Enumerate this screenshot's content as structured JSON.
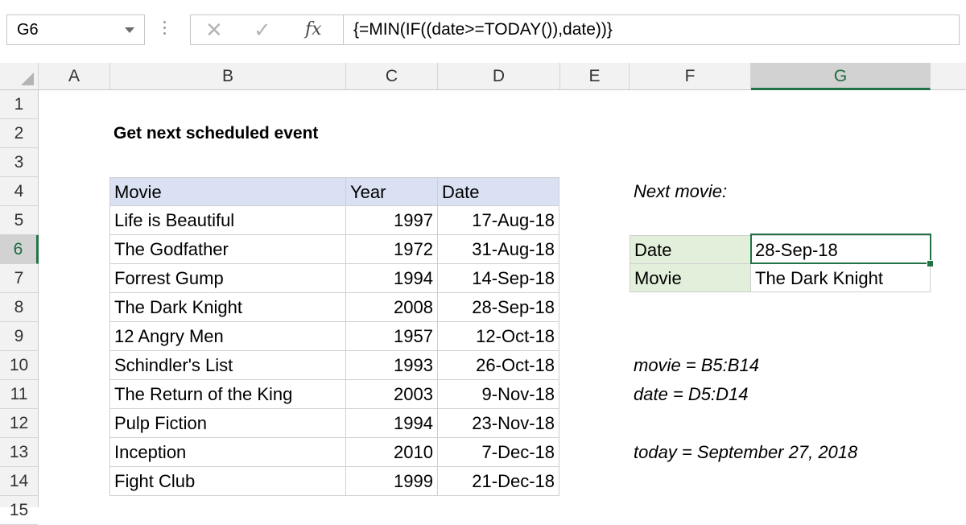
{
  "formula_bar": {
    "name_box": "G6",
    "formula": "{=MIN(IF((date>=TODAY()),date))}",
    "cancel_icon": "x-icon",
    "enter_icon": "check-icon",
    "fx_label": "fx"
  },
  "columns": [
    "A",
    "B",
    "C",
    "D",
    "E",
    "F",
    "G"
  ],
  "rows": [
    "1",
    "2",
    "3",
    "4",
    "5",
    "6",
    "7",
    "8",
    "9",
    "10",
    "11",
    "12",
    "13",
    "14",
    "15"
  ],
  "selected_cell": {
    "column": "G",
    "row": "6"
  },
  "sheet": {
    "title": "Get next scheduled event",
    "table": {
      "headers": [
        "Movie",
        "Year",
        "Date"
      ],
      "rows": [
        [
          "Life is Beautiful",
          "1997",
          "17-Aug-18"
        ],
        [
          "The Godfather",
          "1972",
          "31-Aug-18"
        ],
        [
          "Forrest Gump",
          "1994",
          "14-Sep-18"
        ],
        [
          "The Dark Knight",
          "2008",
          "28-Sep-18"
        ],
        [
          "12 Angry Men",
          "1957",
          "12-Oct-18"
        ],
        [
          "Schindler's List",
          "1993",
          "26-Oct-18"
        ],
        [
          "The Return of the King",
          "2003",
          "9-Nov-18"
        ],
        [
          "Pulp Fiction",
          "1994",
          "23-Nov-18"
        ],
        [
          "Inception",
          "2010",
          "7-Dec-18"
        ],
        [
          "Fight Club",
          "1999",
          "21-Dec-18"
        ]
      ]
    },
    "next_movie_label": "Next movie:",
    "result": {
      "date_label": "Date",
      "date_value": "28-Sep-18",
      "movie_label": "Movie",
      "movie_value": "The Dark Knight"
    },
    "notes": {
      "movie_range": "movie = B5:B14",
      "date_range": "date = D5:D14",
      "today": "today = September 27, 2018"
    }
  },
  "colors": {
    "accent": "#217346",
    "table_header": "#d9e1f2",
    "result_label": "#e2efda"
  }
}
